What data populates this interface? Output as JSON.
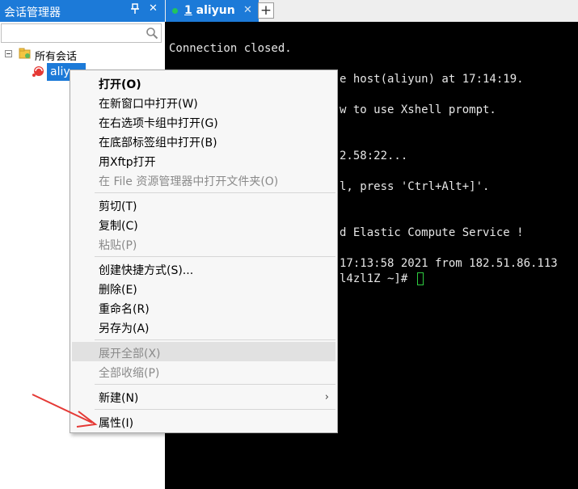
{
  "session_manager": {
    "title": "会话管理器",
    "pin_icon": "pin-icon",
    "close_icon": "close-icon",
    "search": {
      "value": "",
      "placeholder": ""
    },
    "tree": {
      "root_label": "所有会话",
      "session_label": "aliy"
    }
  },
  "tabs": {
    "active": {
      "number": "1",
      "label": "aliyun",
      "status_color": "#22c55e"
    },
    "add_label": "+"
  },
  "terminal": {
    "lines": [
      "Connection closed.",
      "e host(aliyun) at 17:14:19.",
      "w to use Xshell prompt.",
      "2.58:22...",
      "l, press 'Ctrl+Alt+]'.",
      "d Elastic Compute Service !",
      "17:13:58 2021 from 182.51.86.113",
      "l4zl1Z ~]#"
    ]
  },
  "context_menu": {
    "items": [
      {
        "label": "打开(O)"
      },
      {
        "label": "在新窗口中打开(W)"
      },
      {
        "label": "在右选项卡组中打开(G)"
      },
      {
        "label": "在底部标签组中打开(B)"
      },
      {
        "label": "用Xftp打开"
      },
      {
        "label": "在 File 资源管理器中打开文件夹(O)"
      },
      {
        "label": "剪切(T)"
      },
      {
        "label": "复制(C)"
      },
      {
        "label": "粘贴(P)"
      },
      {
        "label": "创建快捷方式(S)..."
      },
      {
        "label": "删除(E)"
      },
      {
        "label": "重命名(R)"
      },
      {
        "label": "另存为(A)"
      },
      {
        "label": "展开全部(X)"
      },
      {
        "label": "全部收缩(P)"
      },
      {
        "label": "新建(N)"
      },
      {
        "label": "属性(I)"
      }
    ]
  },
  "colors": {
    "accent": "#1c7ad8",
    "terminal_bg": "#000000",
    "annotation": "#e53935"
  }
}
